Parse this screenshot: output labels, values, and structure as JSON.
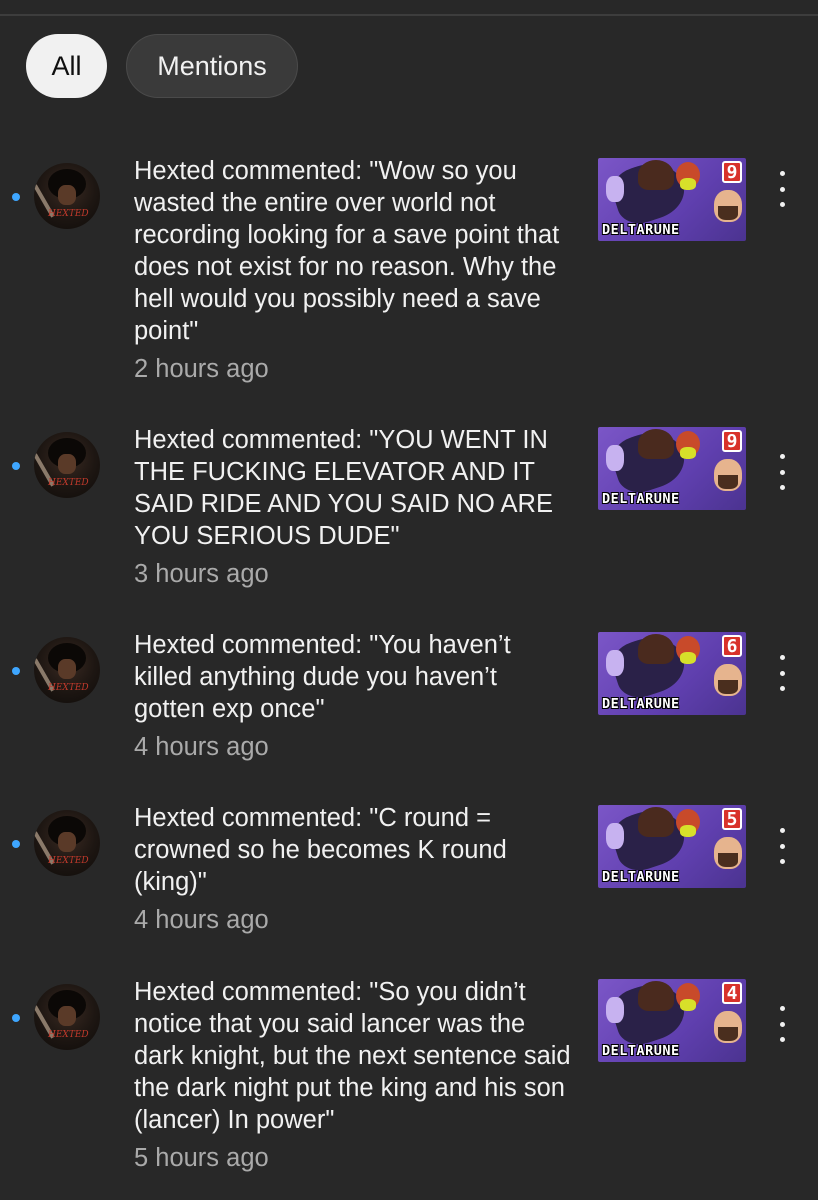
{
  "filters": {
    "all_label": "All",
    "mentions_label": "Mentions"
  },
  "colors": {
    "unread_dot": "#3ea6ff",
    "background": "#282828",
    "secondary_text": "#aaaaaa"
  },
  "notifications": [
    {
      "text": "Hexted commented: \"Wow so you wasted the entire over world not recording looking for a save point that does not exist for no reason. Why the hell would you possibly need a save point\"",
      "time": "2 hours ago",
      "avatar_tag": "HEXTED",
      "thumb_number": "9",
      "thumb_title": "DELTARUNE"
    },
    {
      "text": "Hexted commented: \"YOU WENT IN THE FUCKING ELEVATOR AND IT SAID RIDE AND YOU SAID NO ARE YOU SERIOUS DUDE\"",
      "time": "3 hours ago",
      "avatar_tag": "HEXTED",
      "thumb_number": "9",
      "thumb_title": "DELTARUNE"
    },
    {
      "text": "Hexted commented: \"You haven’t killed anything dude you haven’t gotten exp once\"",
      "time": "4 hours ago",
      "avatar_tag": "HEXTED",
      "thumb_number": "6",
      "thumb_title": "DELTARUNE"
    },
    {
      "text": "Hexted commented: \"C round = crowned so he becomes K round (king)\"",
      "time": "4 hours ago",
      "avatar_tag": "HEXTED",
      "thumb_number": "5",
      "thumb_title": "DELTARUNE"
    },
    {
      "text": "Hexted commented: \"So you didn’t notice that you said lancer was the dark knight, but the next sentence said the dark night put the king and his son (lancer) In power\"",
      "time": "5 hours ago",
      "avatar_tag": "HEXTED",
      "thumb_number": "4",
      "thumb_title": "DELTARUNE"
    }
  ]
}
